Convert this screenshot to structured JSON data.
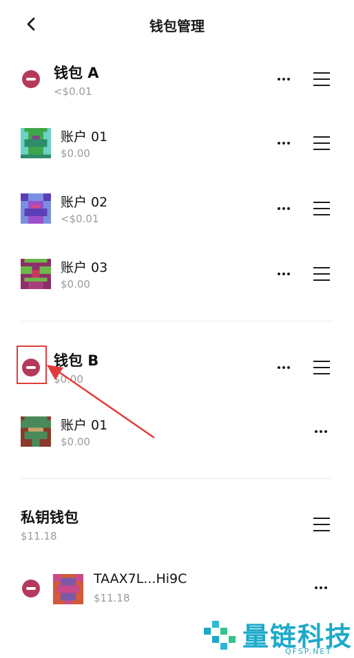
{
  "header": {
    "title": "钱包管理",
    "back_icon": "chevron-left-icon"
  },
  "wallets": [
    {
      "name": "钱包 A",
      "balance": "<$0.01",
      "accounts": [
        {
          "name": "账户 01",
          "balance": "$0.00"
        },
        {
          "name": "账户 02",
          "balance": "<$0.01"
        },
        {
          "name": "账户 03",
          "balance": "$0.00"
        }
      ]
    },
    {
      "name": "钱包 B",
      "balance": "$0.00",
      "accounts": [
        {
          "name": "账户 01",
          "balance": "$0.00"
        }
      ]
    }
  ],
  "private_key_wallet": {
    "title": "私钥钱包",
    "balance": "$11.18",
    "accounts": [
      {
        "name": "TAAX7L...Hi9C",
        "balance": "$11.18"
      }
    ]
  },
  "watermark": {
    "text": "量链科技",
    "sub": "QFSP.NET"
  },
  "colors": {
    "accent_remove": "#b5395c",
    "annotation": "#e03b3b",
    "watermark": "#1da9c9"
  }
}
